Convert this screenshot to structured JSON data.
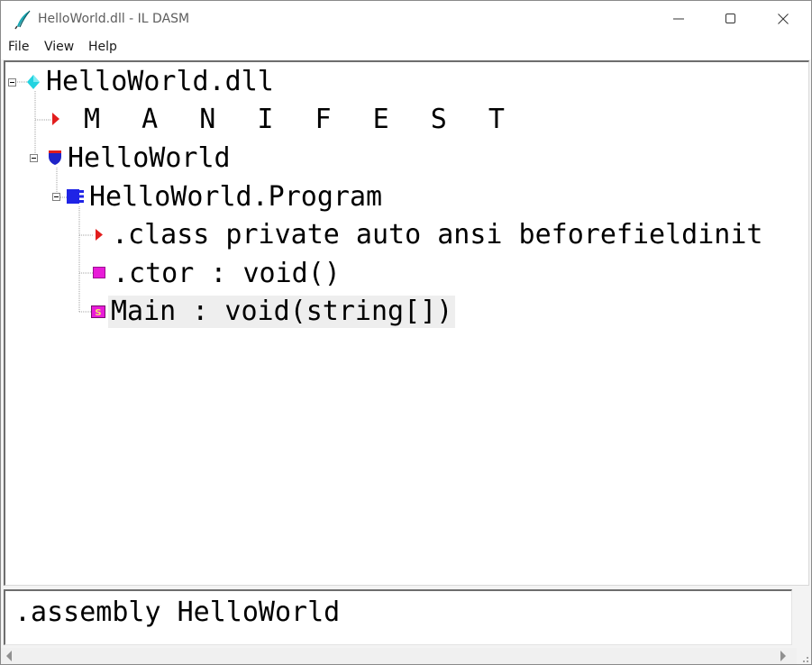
{
  "window": {
    "title": "HelloWorld.dll - IL DASM",
    "app_icon": "feather-pen-icon",
    "controls": [
      "minimize-icon",
      "maximize-icon",
      "close-icon"
    ]
  },
  "menu": {
    "file": "File",
    "view": "View",
    "help": "Help"
  },
  "tree": {
    "root": {
      "label": "HelloWorld.dll",
      "icon": "assembly-diamond-icon",
      "expanded": true
    },
    "manifest": {
      "label": "M A N I F E S T",
      "icon": "manifest-triangle-icon"
    },
    "namespace": {
      "label": "HelloWorld",
      "icon": "namespace-shield-icon",
      "expanded": true
    },
    "class": {
      "label": "HelloWorld.Program",
      "icon": "class-icon",
      "expanded": true
    },
    "class_info": {
      "label": ".class private auto ansi beforefieldinit",
      "icon": "info-triangle-icon"
    },
    "ctor": {
      "label": ".ctor : void()",
      "icon": "method-icon"
    },
    "main": {
      "label": "Main : void(string[])",
      "icon": "static-method-icon",
      "selected": true
    }
  },
  "detail": {
    "text": ".assembly HelloWorld"
  },
  "colors": {
    "assembly": "#22d3e0",
    "triangle": "#e21d1d",
    "namespace": "#1f24c8",
    "class": "#1f24e6",
    "method": "#e81bd8",
    "selection": "#eeeeee"
  }
}
